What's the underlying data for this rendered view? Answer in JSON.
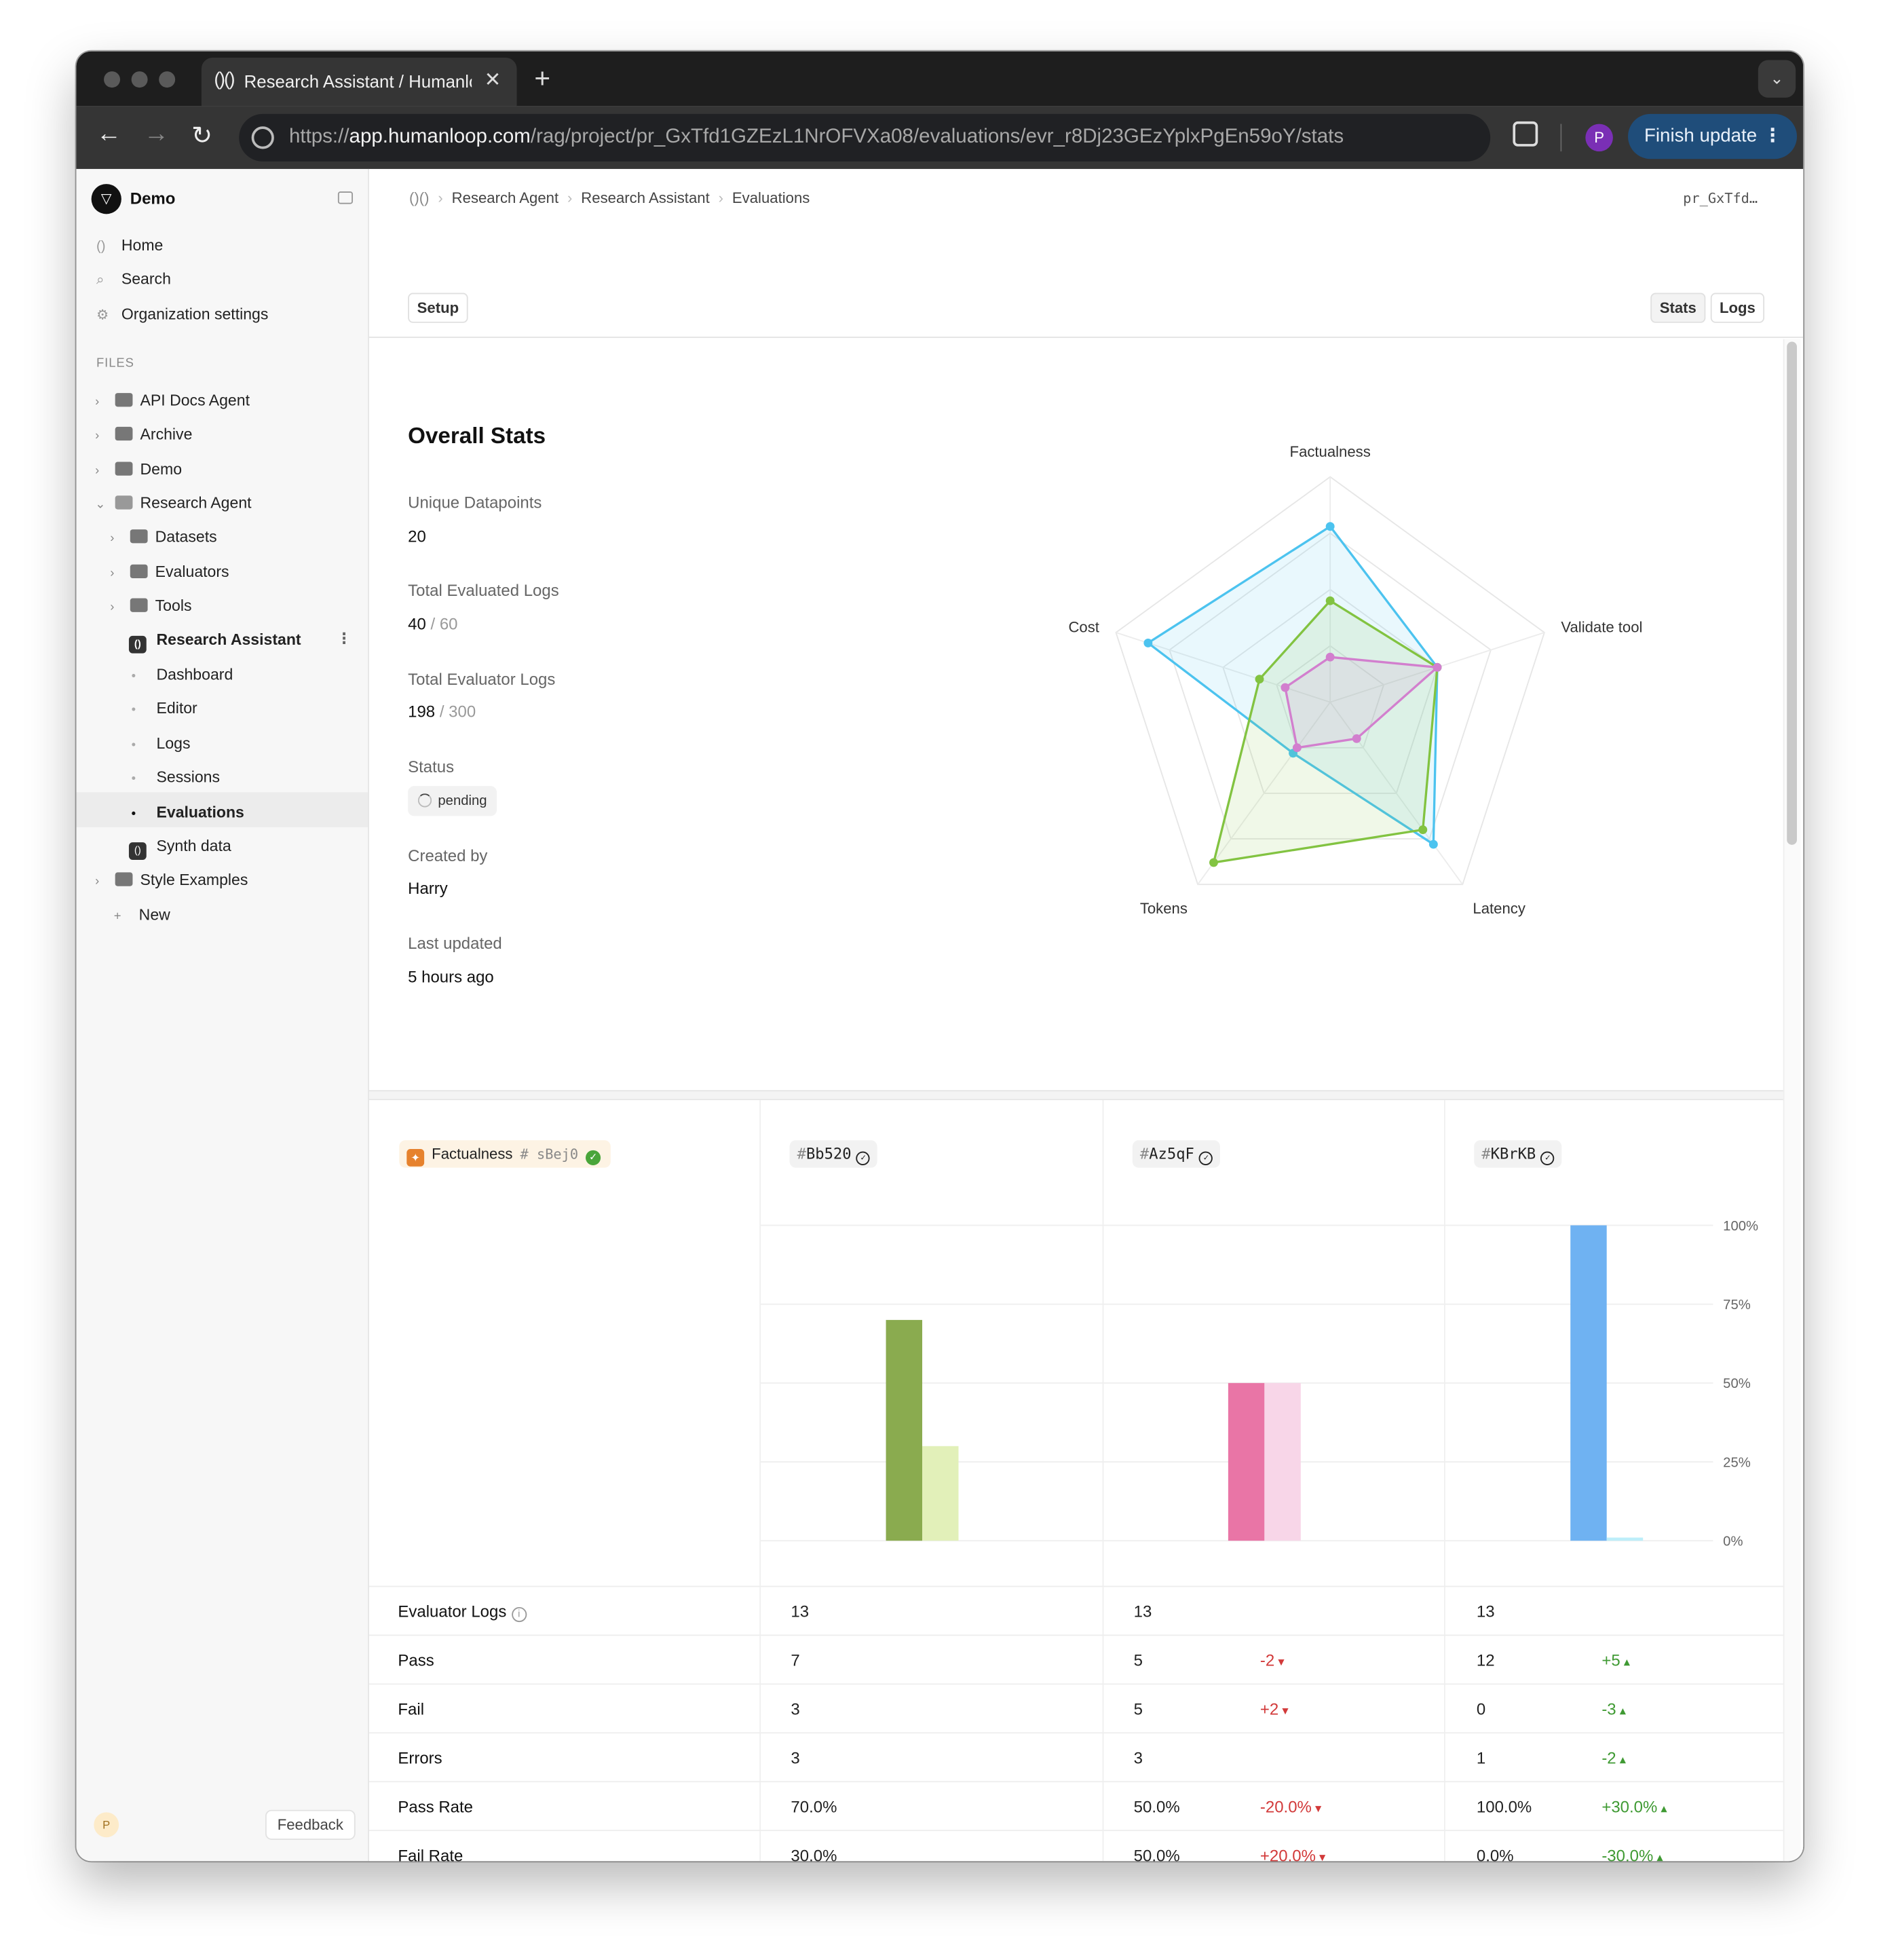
{
  "browser": {
    "tab_title": "Research Assistant / Humanloop",
    "tab_logo": "humanloop-logo",
    "url_prefix": "https://",
    "url_host": "app.humanloop.com",
    "url_path": "/rag/project/pr_GxTfd1GZEzL1NrOFVXa08/evaluations/evr_r8Dj23GEzYplxPgEn59oY/stats",
    "profile_initial": "P",
    "finish_update_label": "Finish update"
  },
  "sidebar": {
    "workspace_name": "Demo",
    "nav": [
      {
        "label": "Home",
        "icon": "humanloop-icon"
      },
      {
        "label": "Search",
        "icon": "search-icon"
      },
      {
        "label": "Organization settings",
        "icon": "gear-icon"
      }
    ],
    "files_label": "FILES",
    "tree": [
      {
        "label": "API Docs Agent"
      },
      {
        "label": "Archive"
      },
      {
        "label": "Demo"
      },
      {
        "label": "Research Agent"
      },
      {
        "label": "Datasets"
      },
      {
        "label": "Evaluators"
      },
      {
        "label": "Tools"
      },
      {
        "label": "Research Assistant"
      },
      {
        "label": "Dashboard"
      },
      {
        "label": "Editor"
      },
      {
        "label": "Logs"
      },
      {
        "label": "Sessions"
      },
      {
        "label": "Evaluations"
      },
      {
        "label": "Synth data"
      },
      {
        "label": "Style Examples"
      },
      {
        "label": "New"
      }
    ],
    "user_initial": "P",
    "feedback_label": "Feedback"
  },
  "header": {
    "breadcrumbs": [
      "Research Agent",
      "Research Assistant",
      "Evaluations"
    ],
    "file_id": "pr_GxTfd…",
    "setup_label": "Setup",
    "stats_label": "Stats",
    "logs_label": "Logs"
  },
  "overall": {
    "title": "Overall Stats",
    "unique_datapoints_label": "Unique Datapoints",
    "unique_datapoints": "20",
    "total_evaluated_logs_label": "Total Evaluated Logs",
    "total_evaluated_logs": "40",
    "total_evaluated_logs_of": "/ 60",
    "total_evaluator_logs_label": "Total Evaluator Logs",
    "total_evaluator_logs": "198",
    "total_evaluator_logs_of": "/ 300",
    "status_label": "Status",
    "status": "pending",
    "created_by_label": "Created by",
    "created_by": "Harry",
    "last_updated_label": "Last updated",
    "last_updated": "5 hours ago"
  },
  "evaluator": {
    "name": "Factualness",
    "hash": "sBej0",
    "versions": [
      {
        "hash": "Bb520"
      },
      {
        "hash": "Az5qF"
      },
      {
        "hash": "KBrKB"
      }
    ]
  },
  "table": {
    "rows": [
      {
        "label": "Evaluator Logs",
        "v1": "13",
        "v2": "13",
        "d2": "",
        "v3": "13",
        "d3": ""
      },
      {
        "label": "Pass",
        "v1": "7",
        "v2": "5",
        "d2": "-2",
        "v3": "12",
        "d3": "+5"
      },
      {
        "label": "Fail",
        "v1": "3",
        "v2": "5",
        "d2": "+2",
        "v3": "0",
        "d3": "-3"
      },
      {
        "label": "Errors",
        "v1": "3",
        "v2": "3",
        "d2": "",
        "v3": "1",
        "d3": "-2"
      },
      {
        "label": "Pass Rate",
        "v1": "70.0%",
        "v2": "50.0%",
        "d2": "-20.0%",
        "v3": "100.0%",
        "d3": "+30.0%"
      },
      {
        "label": "Fail Rate",
        "v1": "30.0%",
        "v2": "50.0%",
        "d2": "+20.0%",
        "v3": "0.0%",
        "d3": "-30.0%"
      }
    ]
  },
  "chart_data": [
    {
      "type": "radar",
      "axes": [
        "Factualness",
        "Validate tool",
        "Latency",
        "Tokens",
        "Cost"
      ],
      "range": [
        0,
        1
      ],
      "grid": true,
      "series": [
        {
          "color": "#4cc3ef",
          "values": [
            0.78,
            0.5,
            0.78,
            0.28,
            0.85
          ]
        },
        {
          "color": "#82c341",
          "values": [
            0.45,
            0.5,
            0.7,
            0.88,
            0.33
          ]
        },
        {
          "color": "#d27fce",
          "values": [
            0.2,
            0.5,
            0.2,
            0.25,
            0.21
          ]
        }
      ]
    },
    {
      "type": "bar",
      "categories": [
        "Bb520",
        "Az5qF",
        "KBrKB"
      ],
      "yticks": [
        "0%",
        "25%",
        "50%",
        "75%",
        "100%"
      ],
      "ylim": [
        0,
        100
      ],
      "grid": true,
      "series": [
        {
          "values": [
            70,
            50,
            100
          ],
          "colors": [
            "#8aab4f",
            "#e975a6",
            "#6fb2f2"
          ]
        },
        {
          "values": [
            30,
            50,
            1
          ],
          "colors": [
            "#e2f0b9",
            "#f8d6e8",
            "#bdeefa"
          ]
        }
      ]
    }
  ]
}
